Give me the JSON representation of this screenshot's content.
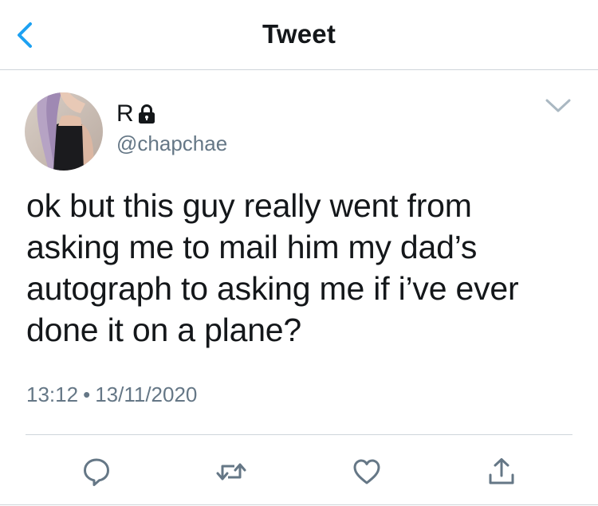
{
  "header": {
    "title": "Tweet",
    "back_icon": "chevron-left-icon",
    "accent_color": "#1da1f2"
  },
  "tweet": {
    "display_name": "R",
    "protected_icon": "lock-icon",
    "handle": "@chapchae",
    "text": "ok but this guy really went from\nasking me to mail him my dad’s\nautograph to asking me if i’ve ever\ndone it on a plane?",
    "time": "13:12",
    "separator": "•",
    "date": "13/11/2020"
  },
  "actions": [
    {
      "name": "reply",
      "icon": "comment-icon"
    },
    {
      "name": "retweet",
      "icon": "retweet-icon"
    },
    {
      "name": "like",
      "icon": "heart-icon"
    },
    {
      "name": "share",
      "icon": "share-icon"
    }
  ],
  "colors": {
    "text": "#14171a",
    "secondary": "#657786",
    "icon": "#657786",
    "divider": "#cfd5da"
  }
}
